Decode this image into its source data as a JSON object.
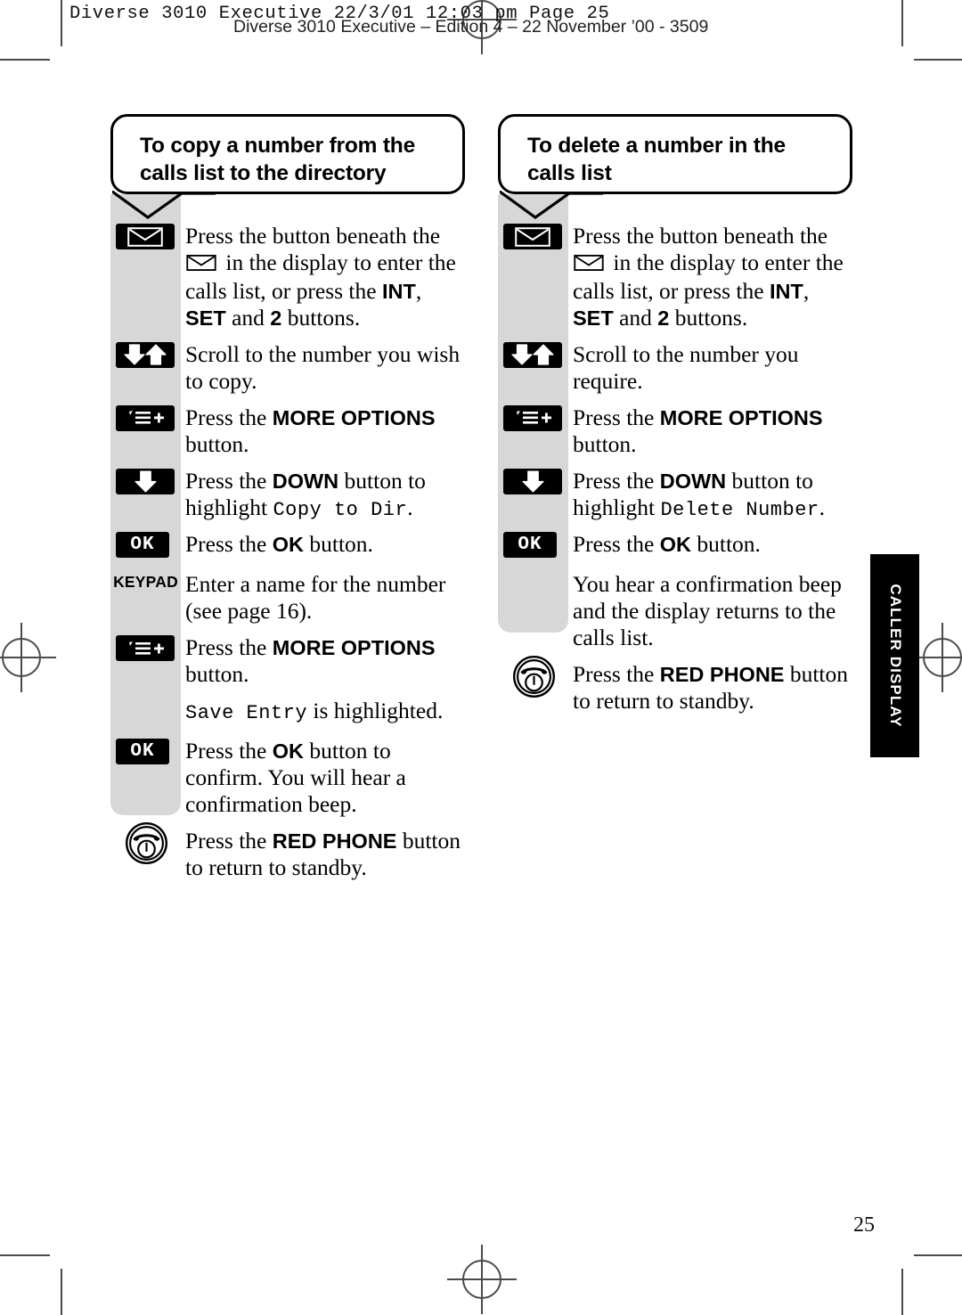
{
  "page": {
    "header_mono": "Diverse 3010 Executive  22/3/01  12:03 pm  Page 25",
    "header_sans": "Diverse 3010 Executive – Edition 4 – 22 November ’00 - 3509",
    "page_number": "25",
    "side_tab": "CALLER DISPLAY",
    "rail_color": "#d7d7d7",
    "key_color": "#000000"
  },
  "columns": [
    {
      "heading": "To copy a number from the calls list to the directory",
      "steps": [
        {
          "icon": "envelope-key-icon",
          "icon_label": "",
          "text_parts": [
            {
              "t": "Press the button beneath the ",
              "s": "n"
            },
            {
              "t": "envelope-glyph",
              "s": "env"
            },
            {
              "t": " in the display to enter the calls list, or press the ",
              "s": "n"
            },
            {
              "t": "INT",
              "s": "b"
            },
            {
              "t": ", ",
              "s": "n"
            },
            {
              "t": "SET",
              "s": "b"
            },
            {
              "t": " and ",
              "s": "n"
            },
            {
              "t": "2",
              "s": "b"
            },
            {
              "t": " buttons.",
              "s": "n"
            }
          ]
        },
        {
          "icon": "down-up-arrows-key-icon",
          "icon_label": "",
          "text_parts": [
            {
              "t": "Scroll to the number you wish to copy.",
              "s": "n"
            }
          ]
        },
        {
          "icon": "more-options-key-icon",
          "icon_label": "",
          "text_parts": [
            {
              "t": "Press the ",
              "s": "n"
            },
            {
              "t": "MORE OPTIONS",
              "s": "b"
            },
            {
              "t": " button.",
              "s": "n"
            }
          ]
        },
        {
          "icon": "down-arrow-key-icon",
          "icon_label": "",
          "text_parts": [
            {
              "t": "Press the ",
              "s": "n"
            },
            {
              "t": "DOWN",
              "s": "b"
            },
            {
              "t": " button to highlight ",
              "s": "n"
            },
            {
              "t": "Copy to Dir",
              "s": "lcd"
            },
            {
              "t": ".",
              "s": "n"
            }
          ]
        },
        {
          "icon": "ok-key-icon",
          "icon_label": "OK",
          "text_parts": [
            {
              "t": "Press the ",
              "s": "n"
            },
            {
              "t": "OK",
              "s": "b"
            },
            {
              "t": " button.",
              "s": "n"
            }
          ]
        },
        {
          "icon": "keypad-label-icon",
          "icon_label": "KEYPAD",
          "text_parts": [
            {
              "t": "Enter a name for the number (see page 16).",
              "s": "n"
            }
          ]
        },
        {
          "icon": "more-options-key-icon",
          "icon_label": "",
          "text_parts": [
            {
              "t": "Press the ",
              "s": "n"
            },
            {
              "t": "MORE OPTIONS",
              "s": "b"
            },
            {
              "t": " button.",
              "s": "n"
            }
          ]
        },
        {
          "icon": "",
          "icon_label": "",
          "text_parts": [
            {
              "t": "Save Entry",
              "s": "lcd"
            },
            {
              "t": " is highlighted.",
              "s": "n"
            }
          ]
        },
        {
          "icon": "ok-key-icon",
          "icon_label": "OK",
          "text_parts": [
            {
              "t": "Press the ",
              "s": "n"
            },
            {
              "t": "OK",
              "s": "b"
            },
            {
              "t": " button to confirm. You will hear a confirmation beep.",
              "s": "n"
            }
          ]
        },
        {
          "icon": "red-phone-key-icon",
          "icon_label": "",
          "text_parts": [
            {
              "t": "Press the ",
              "s": "n"
            },
            {
              "t": "RED PHONE",
              "s": "b"
            },
            {
              "t": " button to return to standby.",
              "s": "n"
            }
          ]
        }
      ]
    },
    {
      "heading": "To delete a number in the calls list",
      "steps": [
        {
          "icon": "envelope-key-icon",
          "icon_label": "",
          "text_parts": [
            {
              "t": "Press the button beneath the ",
              "s": "n"
            },
            {
              "t": "envelope-glyph",
              "s": "env"
            },
            {
              "t": " in the display to enter the calls list, or press the ",
              "s": "n"
            },
            {
              "t": "INT",
              "s": "b"
            },
            {
              "t": ", ",
              "s": "n"
            },
            {
              "t": "SET",
              "s": "b"
            },
            {
              "t": " and ",
              "s": "n"
            },
            {
              "t": "2",
              "s": "b"
            },
            {
              "t": " buttons.",
              "s": "n"
            }
          ]
        },
        {
          "icon": "down-up-arrows-key-icon",
          "icon_label": "",
          "text_parts": [
            {
              "t": "Scroll to the number you require.",
              "s": "n"
            }
          ]
        },
        {
          "icon": "more-options-key-icon",
          "icon_label": "",
          "text_parts": [
            {
              "t": "Press the ",
              "s": "n"
            },
            {
              "t": "MORE OPTIONS",
              "s": "b"
            },
            {
              "t": " button.",
              "s": "n"
            }
          ]
        },
        {
          "icon": "down-arrow-key-icon",
          "icon_label": "",
          "text_parts": [
            {
              "t": "Press the ",
              "s": "n"
            },
            {
              "t": "DOWN",
              "s": "b"
            },
            {
              "t": " button to highlight ",
              "s": "n"
            },
            {
              "t": "Delete Number",
              "s": "lcd"
            },
            {
              "t": ".",
              "s": "n"
            }
          ]
        },
        {
          "icon": "ok-key-icon",
          "icon_label": "OK",
          "text_parts": [
            {
              "t": "Press the ",
              "s": "n"
            },
            {
              "t": "OK",
              "s": "b"
            },
            {
              "t": " button.",
              "s": "n"
            }
          ]
        },
        {
          "icon": "",
          "icon_label": "",
          "text_parts": [
            {
              "t": "You hear a confirmation beep and the display returns to the calls list.",
              "s": "n"
            }
          ]
        },
        {
          "icon": "red-phone-key-icon",
          "icon_label": "",
          "text_parts": [
            {
              "t": "Press the ",
              "s": "n"
            },
            {
              "t": "RED PHONE",
              "s": "b"
            },
            {
              "t": " button to return to standby.",
              "s": "n"
            }
          ]
        }
      ]
    }
  ]
}
